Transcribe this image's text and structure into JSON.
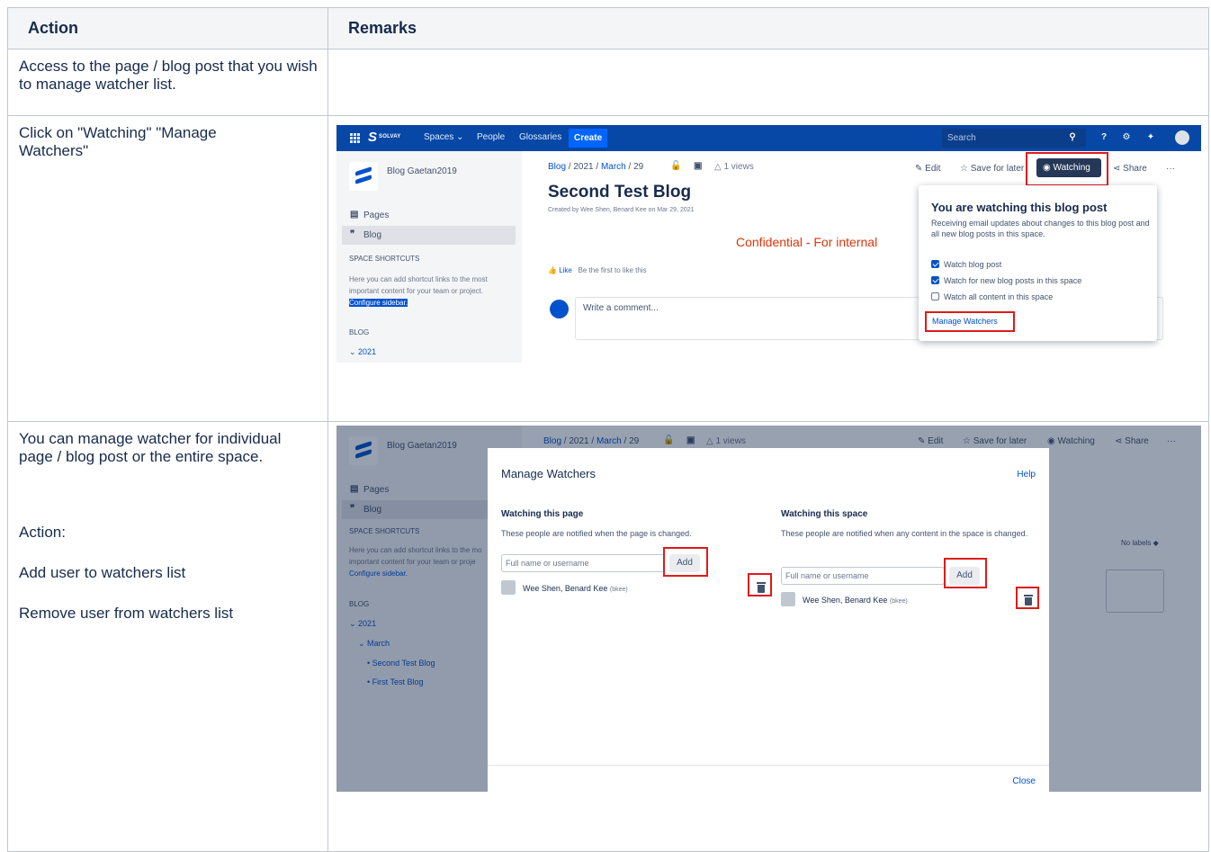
{
  "table": {
    "headers": [
      "Action",
      "Remarks"
    ],
    "rows": [
      {
        "action": "Access to the page / blog post that you wish to manage watcher list."
      },
      {
        "action": "Click on \"Watching\"  \"Manage Watchers\""
      },
      {
        "action_lines": [
          "You can manage watcher for individual page / blog post or the entire space.",
          "Action:",
          "Add user to watchers list",
          "Remove user from watchers list"
        ]
      }
    ]
  },
  "shot1": {
    "topbar": {
      "brand": "SOLVAY",
      "nav": [
        "Spaces",
        "People",
        "Glossaries"
      ],
      "create": "Create",
      "search_placeholder": "Search"
    },
    "sidebar": {
      "space_name": "Blog Gaetan2019",
      "items": [
        "Pages",
        "Blog"
      ],
      "shortcuts_header": "SPACE SHORTCUTS",
      "shortcuts_text": "Here you can add shortcut links to the most important content for your team or project.",
      "configure": "Configure sidebar.",
      "blog_header": "BLOG",
      "year": "2021"
    },
    "breadcrumb": {
      "blog": "Blog",
      "year": "2021",
      "month": "March",
      "day": "29"
    },
    "views": "1 views",
    "actions": {
      "edit": "Edit",
      "save_for_later": "Save for later",
      "watching": "Watching",
      "share": "Share",
      "more": "···"
    },
    "title": "Second Test Blog",
    "byline": "Created by Wee Shen, Benard Kee on Mar 29, 2021",
    "confidential": "Confidential - For internal",
    "like": "Like",
    "like_text": "Be the first to like this",
    "comment_placeholder": "Write a comment...",
    "popup": {
      "title": "You are watching this blog post",
      "desc": "Receiving email updates about changes to this blog post and all new blog posts in this space.",
      "options": [
        {
          "label": "Watch blog post",
          "checked": true
        },
        {
          "label": "Watch for new blog posts in this space",
          "checked": true
        },
        {
          "label": "Watch all content in this space",
          "checked": false
        }
      ],
      "manage": "Manage Watchers"
    }
  },
  "shot2": {
    "sidebar": {
      "space_name": "Blog Gaetan2019",
      "items": [
        "Pages",
        "Blog"
      ],
      "shortcuts_header": "SPACE SHORTCUTS",
      "shortcuts_text1": "Here you can add shortcut links to the mo",
      "shortcuts_text2": "important content for your team or proje",
      "configure": "Configure sidebar.",
      "blog_header": "BLOG",
      "year": "2021",
      "month": "March",
      "posts": [
        "Second Test Blog",
        "First Test Blog"
      ]
    },
    "breadcrumb": {
      "blog": "Blog",
      "year": "2021",
      "month": "March",
      "day": "29"
    },
    "views": "1 views",
    "actions": {
      "edit": "Edit",
      "save_for_later": "Save for later",
      "watching": "Watching",
      "share": "Share",
      "more": "···"
    },
    "no_labels": "No labels",
    "dialog": {
      "title": "Manage Watchers",
      "help": "Help",
      "page_heading": "Watching this page",
      "page_desc": "These people are notified when the page is changed.",
      "space_heading": "Watching this space",
      "space_desc": "These people are notified when any content in the space is changed.",
      "input_placeholder": "Full name or username",
      "add": "Add",
      "user_name": "Wee Shen, Benard Kee",
      "user_id": "(bkee)",
      "close": "Close"
    }
  }
}
